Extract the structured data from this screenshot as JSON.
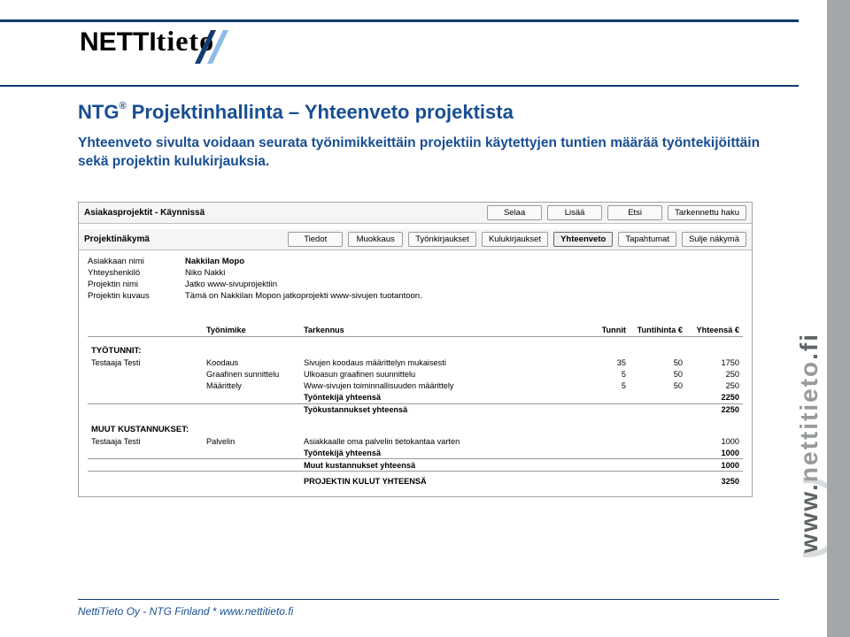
{
  "header": {
    "logo_text_a": "NETTI",
    "logo_text_b": "tieto"
  },
  "sidebar": {
    "url_text": "www.nettitieto.fi"
  },
  "page": {
    "title_prefix": "NTG",
    "title_reg": "®",
    "title_rest": " Projektinhallinta – Yhteenveto projektista",
    "subtitle": "Yhteenveto sivulta voidaan seurata työnimikkeittäin projektiin käytettyjen tuntien määrää työntekijöittäin sekä projektin kulukirjauksia."
  },
  "app": {
    "topbar": {
      "label": "Asiakasprojektit - Käynnissä",
      "buttons": [
        "Selaa",
        "Lisää",
        "Etsi",
        "Tarkennettu haku"
      ]
    },
    "navbar": {
      "label": "Projektinäkymä",
      "tabs": [
        "Tiedot",
        "Muokkaus",
        "Työnkirjaukset",
        "Kulukirjaukset",
        "Yhteenveto",
        "Tapahtumat",
        "Sulje näkymä"
      ],
      "active_index": 4
    },
    "info": [
      {
        "k": "Asiakkaan nimi",
        "v": "Nakkilan Mopo"
      },
      {
        "k": "Yhteyshenkilö",
        "v": "Niko Nakki"
      },
      {
        "k": "Projektin nimi",
        "v": "Jatko www-sivuprojektiin"
      },
      {
        "k": "Projektin kuvaus",
        "v": "Tämä on Nakkilan Mopon jatkoprojekti www-sivujen tuotantoon."
      }
    ],
    "hours": {
      "section": "TYÖTUNNIT:",
      "cols": [
        "",
        "Työnimike",
        "Tarkennus",
        "Tunnit",
        "Tuntihinta €",
        "Yhteensä €"
      ],
      "worker": "Testaaja Testi",
      "rows": [
        {
          "t": "Koodaus",
          "d": "Sivujen koodaus määrittelyn mukaisesti",
          "h": 35,
          "r": 50,
          "s": 1750
        },
        {
          "t": "Graafinen sunnittelu",
          "d": "Ulkoasun graafinen suunnittelu",
          "h": 5,
          "r": 50,
          "s": 250
        },
        {
          "t": "Määrittely",
          "d": "Www-sivujen toiminnallisuuden määrittely",
          "h": 5,
          "r": 50,
          "s": 250
        }
      ],
      "subtotal1_label": "Työntekijä yhteensä",
      "subtotal1": 2250,
      "subtotal2_label": "Työkustannukset yhteensä",
      "subtotal2": 2250
    },
    "other": {
      "section": "MUUT KUSTANNUKSET:",
      "worker": "Testaaja Testi",
      "rows": [
        {
          "t": "Palvelin",
          "d": "Asiakkaalle oma palvelin tietokantaa varten",
          "s": 1000
        }
      ],
      "subtotal1_label": "Työntekijä yhteensä",
      "subtotal1": 1000,
      "subtotal2_label": "Muut kustannukset yhteensä",
      "subtotal2": 1000
    },
    "grand": {
      "label": "PROJEKTIN KULUT YHTEENSÄ",
      "value": 3250
    }
  },
  "footer": {
    "text": "NettiTieto Oy - NTG Finland   *   www.nettitieto.fi"
  }
}
